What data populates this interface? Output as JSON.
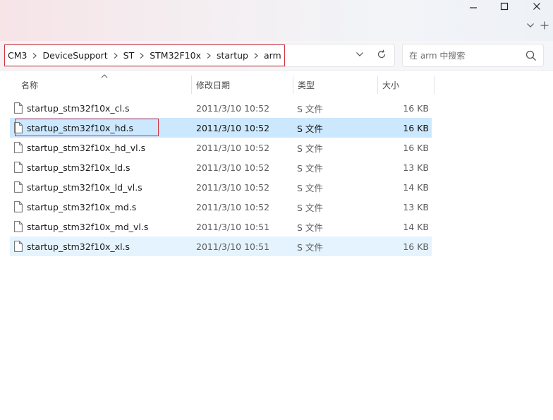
{
  "window": {
    "controls": {
      "minimize": "minimize-icon",
      "maximize": "maximize-icon",
      "close": "close-icon"
    },
    "tab_controls": {
      "expand": "chevron-down-icon",
      "new_tab": "plus-icon"
    }
  },
  "address_bar": {
    "breadcrumbs": [
      "CM3",
      "DeviceSupport",
      "ST",
      "STM32F10x",
      "startup",
      "arm"
    ]
  },
  "search": {
    "placeholder": "在 arm 中搜索"
  },
  "columns": {
    "name": "名称",
    "date": "修改日期",
    "type": "类型",
    "size": "大小"
  },
  "files": [
    {
      "name": "startup_stm32f10x_cl.s",
      "date": "2011/3/10 10:52",
      "type": "S 文件",
      "size": "16 KB",
      "state": "normal"
    },
    {
      "name": "startup_stm32f10x_hd.s",
      "date": "2011/3/10 10:52",
      "type": "S 文件",
      "size": "16 KB",
      "state": "selected"
    },
    {
      "name": "startup_stm32f10x_hd_vl.s",
      "date": "2011/3/10 10:52",
      "type": "S 文件",
      "size": "16 KB",
      "state": "normal"
    },
    {
      "name": "startup_stm32f10x_ld.s",
      "date": "2011/3/10 10:52",
      "type": "S 文件",
      "size": "13 KB",
      "state": "normal"
    },
    {
      "name": "startup_stm32f10x_ld_vl.s",
      "date": "2011/3/10 10:52",
      "type": "S 文件",
      "size": "14 KB",
      "state": "normal"
    },
    {
      "name": "startup_stm32f10x_md.s",
      "date": "2011/3/10 10:52",
      "type": "S 文件",
      "size": "13 KB",
      "state": "normal"
    },
    {
      "name": "startup_stm32f10x_md_vl.s",
      "date": "2011/3/10 10:51",
      "type": "S 文件",
      "size": "14 KB",
      "state": "normal"
    },
    {
      "name": "startup_stm32f10x_xl.s",
      "date": "2011/3/10 10:51",
      "type": "S 文件",
      "size": "16 KB",
      "state": "hover"
    }
  ],
  "colors": {
    "selected_row": "#cce8ff",
    "hover_row": "#e5f3ff",
    "highlight_box": "#d2323c"
  }
}
